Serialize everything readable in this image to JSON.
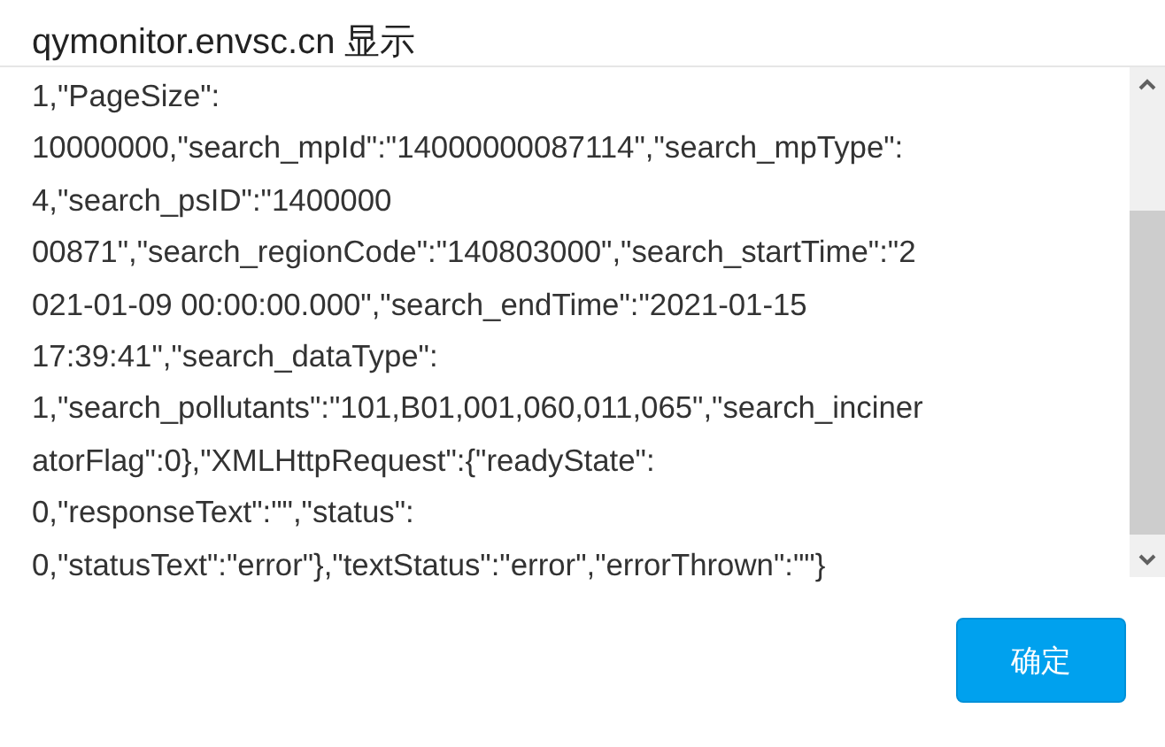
{
  "dialog": {
    "title": "qymonitor.envsc.cn 显示",
    "message_lines": [
      "1,\"PageSize\":",
      "10000000,\"search_mpId\":\"14000000087114\",\"search_mpType\":",
      "4,\"search_psID\":\"1400000",
      "00871\",\"search_regionCode\":\"140803000\",\"search_startTime\":\"2",
      "021-01-09 00:00:00.000\",\"search_endTime\":\"2021-01-15",
      "17:39:41\",\"search_dataType\":",
      "1,\"search_pollutants\":\"101,B01,001,060,011,065\",\"search_inciner",
      "atorFlag\":0},\"XMLHttpRequest\":{\"readyState\":",
      "0,\"responseText\":\"\",\"status\":",
      "0,\"statusText\":\"error\"},\"textStatus\":\"error\",\"errorThrown\":\"\"}"
    ],
    "buttons": [
      {
        "label": "确定",
        "kind": "primary"
      }
    ]
  }
}
